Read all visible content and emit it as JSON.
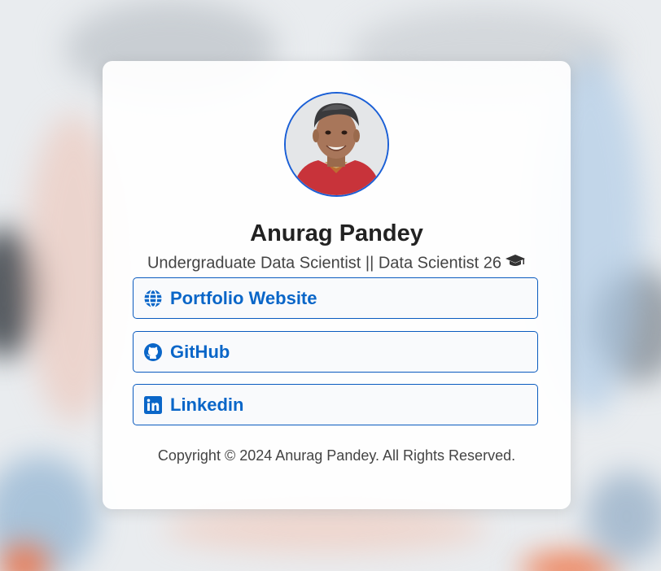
{
  "profile": {
    "name": "Anurag Pandey",
    "subtitle": "Undergraduate Data Scientist || Data Scientist 26",
    "subtitle_icon": "graduation-cap-icon"
  },
  "links": [
    {
      "label": "Portfolio Website",
      "icon": "globe-icon"
    },
    {
      "label": "GitHub",
      "icon": "github-icon"
    },
    {
      "label": "Linkedin",
      "icon": "linkedin-icon"
    }
  ],
  "footer": {
    "copyright": "Copyright © 2024 Anurag Pandey. All Rights Reserved."
  },
  "colors": {
    "accent": "#0a66c8",
    "border": "#0a5bbf",
    "text": "#222222"
  }
}
